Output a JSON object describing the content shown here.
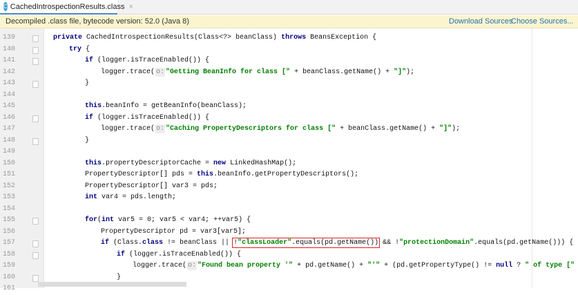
{
  "tab": {
    "icon": "class-file-icon",
    "icon_letter": "C",
    "title": "CachedIntrospectionResults.class",
    "close": "×"
  },
  "banner": {
    "text": "Decompiled .class file, bytecode version: 52.0 (Java 8)",
    "download": "Download Sources",
    "choose": "Choose Sources..."
  },
  "hint_label": "o:",
  "lines": [
    {
      "n": "139",
      "fold": true,
      "indent": 0,
      "tokens": [
        [
          "k",
          "private "
        ],
        [
          "t",
          "CachedIntrospectionResults(Class<?> beanClass) "
        ],
        [
          "k",
          "throws "
        ],
        [
          "t",
          "BeansException {"
        ]
      ]
    },
    {
      "n": "140",
      "fold": true,
      "indent": 1,
      "tokens": [
        [
          "k",
          "try "
        ],
        [
          "t",
          "{"
        ]
      ]
    },
    {
      "n": "141",
      "fold": true,
      "indent": 2,
      "tokens": [
        [
          "k",
          "if "
        ],
        [
          "t",
          "(logger.isTraceEnabled()) {"
        ]
      ]
    },
    {
      "n": "142",
      "indent": 3,
      "tokens": [
        [
          "t",
          "logger.trace("
        ],
        [
          "h",
          ""
        ],
        [
          "s",
          "\"Getting BeanInfo for class [\""
        ],
        [
          "t",
          " + beanClass.getName() + "
        ],
        [
          "s",
          "\"]\""
        ],
        [
          "t",
          ");"
        ]
      ]
    },
    {
      "n": "143",
      "fold": true,
      "indent": 2,
      "tokens": [
        [
          "t",
          "}"
        ]
      ]
    },
    {
      "n": "144",
      "indent": 0,
      "tokens": []
    },
    {
      "n": "145",
      "indent": 2,
      "tokens": [
        [
          "k",
          "this"
        ],
        [
          "t",
          ".beanInfo = getBeanInfo(beanClass);"
        ]
      ]
    },
    {
      "n": "146",
      "fold": true,
      "indent": 2,
      "tokens": [
        [
          "k",
          "if "
        ],
        [
          "t",
          "(logger.isTraceEnabled()) {"
        ]
      ]
    },
    {
      "n": "147",
      "indent": 3,
      "tokens": [
        [
          "t",
          "logger.trace("
        ],
        [
          "h",
          ""
        ],
        [
          "s",
          "\"Caching PropertyDescriptors for class [\""
        ],
        [
          "t",
          " + beanClass.getName() + "
        ],
        [
          "s",
          "\"]\""
        ],
        [
          "t",
          ");"
        ]
      ]
    },
    {
      "n": "148",
      "fold": true,
      "indent": 2,
      "tokens": [
        [
          "t",
          "}"
        ]
      ]
    },
    {
      "n": "149",
      "indent": 0,
      "tokens": []
    },
    {
      "n": "150",
      "indent": 2,
      "tokens": [
        [
          "k",
          "this"
        ],
        [
          "t",
          ".propertyDescriptorCache = "
        ],
        [
          "k",
          "new "
        ],
        [
          "t",
          "LinkedHashMap();"
        ]
      ]
    },
    {
      "n": "151",
      "indent": 2,
      "tokens": [
        [
          "t",
          "PropertyDescriptor[] pds = "
        ],
        [
          "k",
          "this"
        ],
        [
          "t",
          ".beanInfo.getPropertyDescriptors();"
        ]
      ]
    },
    {
      "n": "152",
      "indent": 2,
      "tokens": [
        [
          "t",
          "PropertyDescriptor[] var3 = pds;"
        ]
      ]
    },
    {
      "n": "153",
      "indent": 2,
      "tokens": [
        [
          "k",
          "int "
        ],
        [
          "t",
          "var4 = pds.length;"
        ]
      ]
    },
    {
      "n": "154",
      "indent": 0,
      "tokens": []
    },
    {
      "n": "155",
      "fold": true,
      "indent": 2,
      "tokens": [
        [
          "k",
          "for"
        ],
        [
          "t",
          "("
        ],
        [
          "k",
          "int "
        ],
        [
          "t",
          "var5 = 0; var5 < var4; ++var5) {"
        ]
      ]
    },
    {
      "n": "156",
      "indent": 3,
      "tokens": [
        [
          "t",
          "PropertyDescriptor pd = var3[var5];"
        ]
      ]
    },
    {
      "n": "157",
      "fold": true,
      "indent": 3,
      "tokens": [
        [
          "k",
          "if "
        ],
        [
          "t",
          "(Class."
        ],
        [
          "k",
          "class "
        ],
        [
          "t",
          "!= beanClass || "
        ],
        [
          "box",
          "!",
          "\"classLoader\"",
          ".equals(pd.getName())"
        ],
        [
          "t",
          " && !"
        ],
        [
          "s",
          "\"protectionDomain\""
        ],
        [
          "t",
          ".equals(pd.getName())) {"
        ]
      ]
    },
    {
      "n": "158",
      "fold": true,
      "indent": 4,
      "tokens": [
        [
          "k",
          "if "
        ],
        [
          "t",
          "(logger.isTraceEnabled()) {"
        ]
      ]
    },
    {
      "n": "159",
      "indent": 5,
      "tokens": [
        [
          "t",
          "logger.trace("
        ],
        [
          "h",
          ""
        ],
        [
          "s",
          "\"Found bean property '\""
        ],
        [
          "t",
          " + pd.getName() + "
        ],
        [
          "s",
          "\"'\""
        ],
        [
          "t",
          " + (pd.getPropertyType() != "
        ],
        [
          "k",
          "null "
        ],
        [
          "t",
          "? "
        ],
        [
          "s",
          "\" of type [\""
        ]
      ]
    },
    {
      "n": "160",
      "fold": true,
      "indent": 4,
      "tokens": [
        [
          "t",
          "}"
        ]
      ]
    },
    {
      "n": "161",
      "indent": 0,
      "tokens": []
    }
  ]
}
